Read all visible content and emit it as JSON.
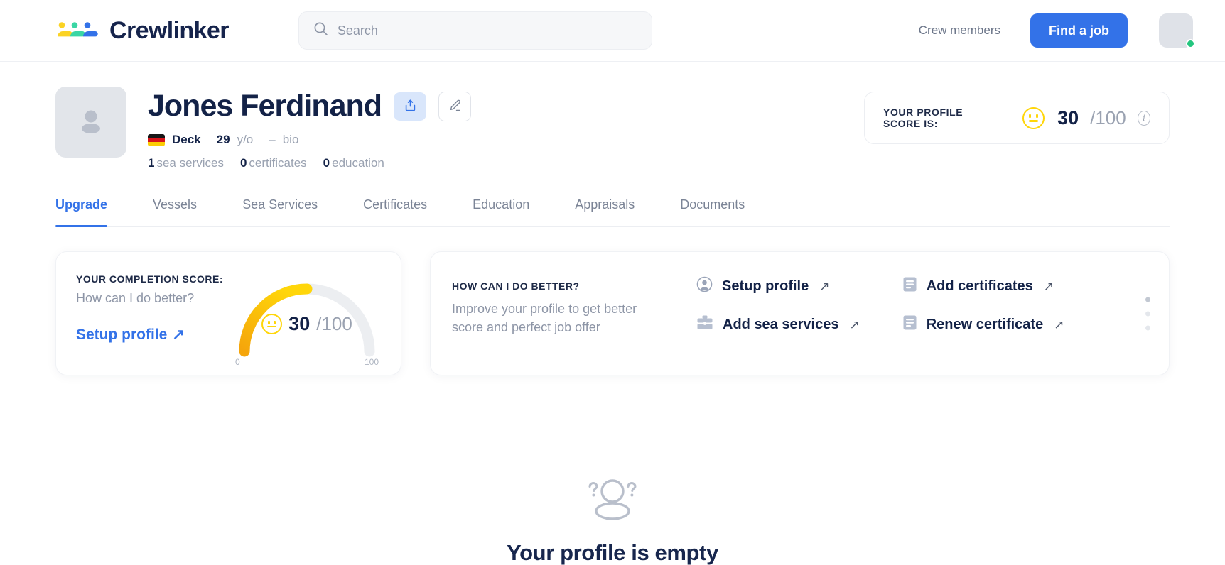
{
  "header": {
    "brand_name": "Crewlinker",
    "logo_icon": "crewlinker-logo",
    "search": {
      "placeholder": "Search",
      "value": "",
      "icon": "search-icon"
    },
    "crew_members_label": "Crew members",
    "find_job_label": "Find a job",
    "avatar_icon": "user-avatar",
    "status": "online",
    "accent_color": "#3372e8"
  },
  "profile": {
    "avatar_icon": "profile-placeholder-icon",
    "name": "Jones Ferdinand",
    "share_icon": "share-icon",
    "edit_icon": "pencil-edit-icon",
    "country": "Germany",
    "rank": "Deck",
    "age": "29",
    "age_unit": "y/o",
    "separator": "–",
    "bio": "bio",
    "counts": [
      {
        "value": "1",
        "label": "sea services"
      },
      {
        "value": "0",
        "label": "certificates"
      },
      {
        "value": "0",
        "label": "education"
      }
    ],
    "score_pill": {
      "label": "YOUR PROFILE SCORE IS:",
      "face_icon": "neutral-face-icon",
      "score": "30",
      "denominator": "/100",
      "info_icon": "info-icon"
    }
  },
  "tabs": [
    {
      "label": "Upgrade",
      "active": true
    },
    {
      "label": "Vessels",
      "active": false
    },
    {
      "label": "Sea Services",
      "active": false
    },
    {
      "label": "Certificates",
      "active": false
    },
    {
      "label": "Education",
      "active": false
    },
    {
      "label": "Appraisals",
      "active": false
    },
    {
      "label": "Documents",
      "active": false
    }
  ],
  "completion_card": {
    "title": "YOUR COMPLETION SCORE:",
    "subtitle": "How can I do better?",
    "link_label": "Setup profile",
    "link_arrow": "↗",
    "face_icon": "neutral-face-icon",
    "score": "30",
    "denominator": "/100",
    "gauge_min": "0",
    "gauge_max": "100"
  },
  "better_card": {
    "title": "HOW CAN I DO BETTER?",
    "subtitle": "Improve your profile to get better score and perfect job offer",
    "actions": [
      {
        "label": "Setup profile",
        "icon": "user-circle-icon",
        "arrow": "↗"
      },
      {
        "label": "Add certificates",
        "icon": "document-icon",
        "arrow": "↗"
      },
      {
        "label": "Add sea services",
        "icon": "briefcase-icon",
        "arrow": "↗"
      },
      {
        "label": "Renew certificate",
        "icon": "document-icon",
        "arrow": "↗"
      }
    ],
    "dots": [
      {
        "active": true
      },
      {
        "active": false
      },
      {
        "active": false
      }
    ]
  },
  "empty_state": {
    "icon": "person-question-icon",
    "title": "Your profile is empty"
  },
  "chart_data": {
    "type": "gauge",
    "title": "YOUR COMPLETION SCORE:",
    "value": 30,
    "min": 0,
    "max": 100,
    "unit": "/100",
    "arc_start_color": "#f5a50b",
    "arc_end_color": "#ffd60a",
    "track_color": "#eceef1"
  }
}
